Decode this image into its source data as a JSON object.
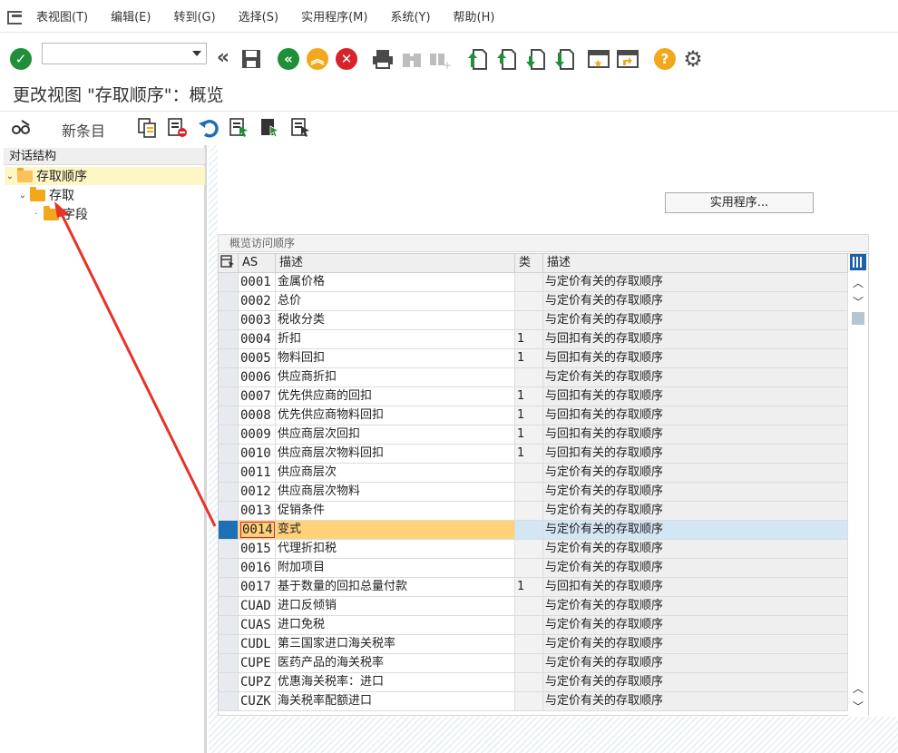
{
  "menu": [
    "表视图(T)",
    "编辑(E)",
    "转到(G)",
    "选择(S)",
    "实用程序(M)",
    "系统(Y)",
    "帮助(H)"
  ],
  "command_field": {
    "value": "",
    "placeholder": ""
  },
  "title": "更改视图 \"存取顺序\"：概览",
  "app_toolbar": {
    "new_entry": "新条目"
  },
  "tree": {
    "header": "对话结构",
    "items": [
      {
        "label": "存取顺序",
        "level": 0,
        "expanded": true,
        "selected": true
      },
      {
        "label": "存取",
        "level": 1,
        "expanded": true,
        "selected": false
      },
      {
        "label": "字段",
        "level": 2,
        "expanded": false,
        "selected": false
      }
    ]
  },
  "util_button": "实用程序...",
  "table": {
    "caption": "概览访问顺序",
    "columns": [
      "AS",
      "描述",
      "类",
      "描述"
    ],
    "rows": [
      {
        "as": "0001",
        "desc": "金属价格",
        "cls": "",
        "desc2": "与定价有关的存取顺序"
      },
      {
        "as": "0002",
        "desc": "总价",
        "cls": "",
        "desc2": "与定价有关的存取顺序"
      },
      {
        "as": "0003",
        "desc": "税收分类",
        "cls": "",
        "desc2": "与定价有关的存取顺序"
      },
      {
        "as": "0004",
        "desc": "折扣",
        "cls": "1",
        "desc2": "与回扣有关的存取顺序"
      },
      {
        "as": "0005",
        "desc": "物料回扣",
        "cls": "1",
        "desc2": "与回扣有关的存取顺序"
      },
      {
        "as": "0006",
        "desc": "供应商折扣",
        "cls": "",
        "desc2": "与定价有关的存取顺序"
      },
      {
        "as": "0007",
        "desc": "优先供应商的回扣",
        "cls": "1",
        "desc2": "与回扣有关的存取顺序"
      },
      {
        "as": "0008",
        "desc": "优先供应商物料回扣",
        "cls": "1",
        "desc2": "与回扣有关的存取顺序"
      },
      {
        "as": "0009",
        "desc": "供应商层次回扣",
        "cls": "1",
        "desc2": "与回扣有关的存取顺序"
      },
      {
        "as": "0010",
        "desc": "供应商层次物料回扣",
        "cls": "1",
        "desc2": "与回扣有关的存取顺序"
      },
      {
        "as": "0011",
        "desc": "供应商层次",
        "cls": "",
        "desc2": "与定价有关的存取顺序"
      },
      {
        "as": "0012",
        "desc": "供应商层次物料",
        "cls": "",
        "desc2": "与定价有关的存取顺序"
      },
      {
        "as": "0013",
        "desc": "促销条件",
        "cls": "",
        "desc2": "与定价有关的存取顺序"
      },
      {
        "as": "0014",
        "desc": "变式",
        "cls": "",
        "desc2": "与定价有关的存取顺序",
        "highlight": true
      },
      {
        "as": "0015",
        "desc": "代理折扣税",
        "cls": "",
        "desc2": "与定价有关的存取顺序"
      },
      {
        "as": "0016",
        "desc": "附加项目",
        "cls": "",
        "desc2": "与定价有关的存取顺序"
      },
      {
        "as": "0017",
        "desc": "基于数量的回扣总量付款",
        "cls": "1",
        "desc2": "与回扣有关的存取顺序"
      },
      {
        "as": "CUAD",
        "desc": "进口反倾销",
        "cls": "",
        "desc2": "与定价有关的存取顺序"
      },
      {
        "as": "CUAS",
        "desc": "进口免税",
        "cls": "",
        "desc2": "与定价有关的存取顺序"
      },
      {
        "as": "CUDL",
        "desc": "第三国家进口海关税率",
        "cls": "",
        "desc2": "与定价有关的存取顺序"
      },
      {
        "as": "CUPE",
        "desc": "医药产品的海关税率",
        "cls": "",
        "desc2": "与定价有关的存取顺序"
      },
      {
        "as": "CUPZ",
        "desc": "优惠海关税率：进口",
        "cls": "",
        "desc2": "与定价有关的存取顺序"
      },
      {
        "as": "CUZK",
        "desc": "海关税率配额进口",
        "cls": "",
        "desc2": "与定价有关的存取顺序"
      }
    ]
  },
  "colors": {
    "accent": "#1f6fb5",
    "highlight_row": "#ffd27a",
    "tree_selected": "#fff6c5",
    "annotation_arrow": "#e8312a"
  }
}
